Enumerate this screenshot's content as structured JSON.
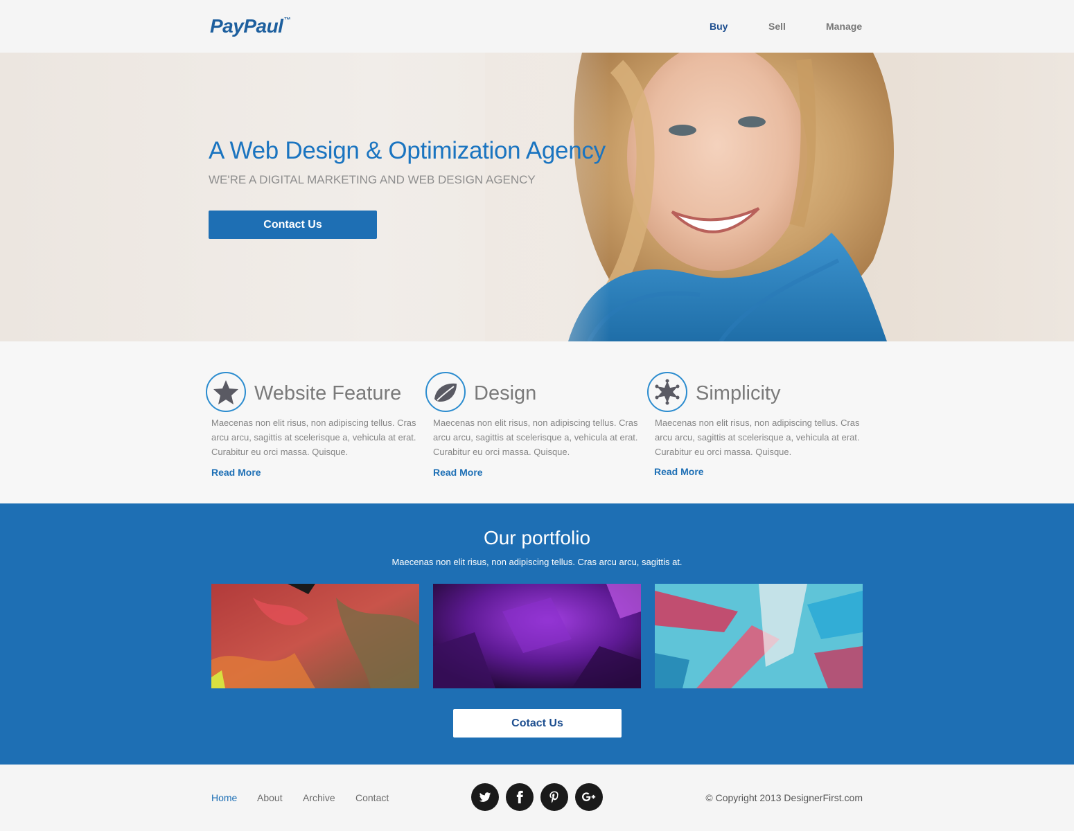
{
  "header": {
    "logo": "PayPaul",
    "logo_tm": "™",
    "nav": [
      "Buy",
      "Sell",
      "Manage"
    ]
  },
  "hero": {
    "title": "A Web Design & Optimization Agency",
    "subtitle": "WE'RE A DIGITAL MARKETING AND WEB DESIGN AGENCY",
    "button": "Contact Us"
  },
  "features": [
    {
      "icon": "star-icon",
      "title": "Website Feature",
      "text": "Maecenas non elit risus, non adipiscing tellus. Cras arcu arcu, sagittis at scelerisque a, vehicula at erat. Curabitur eu orci massa. Quisque.",
      "link": "Read More"
    },
    {
      "icon": "leaf-icon",
      "title": "Design",
      "text": "Maecenas non elit risus, non adipiscing tellus. Cras arcu arcu, sagittis at scelerisque a, vehicula at erat. Curabitur eu orci massa. Quisque.",
      "link": "Read More"
    },
    {
      "icon": "sheriff-star-icon",
      "title": "Simplicity",
      "text": "Maecenas non elit risus, non adipiscing tellus. Cras arcu arcu, sagittis at scelerisque a, vehicula at erat. Curabitur eu orci massa. Quisque.",
      "link": "Read More"
    }
  ],
  "portfolio": {
    "title": "Our portfolio",
    "subtitle": "Maecenas non elit risus, non adipiscing tellus. Cras arcu arcu, sagittis at.",
    "button": "Cotact Us"
  },
  "footer": {
    "nav": [
      "Home",
      "About",
      "Archive",
      "Contact"
    ],
    "social": [
      "twitter-icon",
      "facebook-icon",
      "pinterest-icon",
      "google-plus-icon"
    ],
    "copyright": "© Copyright 2013 DesignerFirst.com"
  },
  "colors": {
    "accent": "#1e6fb4",
    "title_blue": "#1a74c0",
    "nav_active": "#1d4e8f",
    "social_bg": "#1a1a1a"
  }
}
